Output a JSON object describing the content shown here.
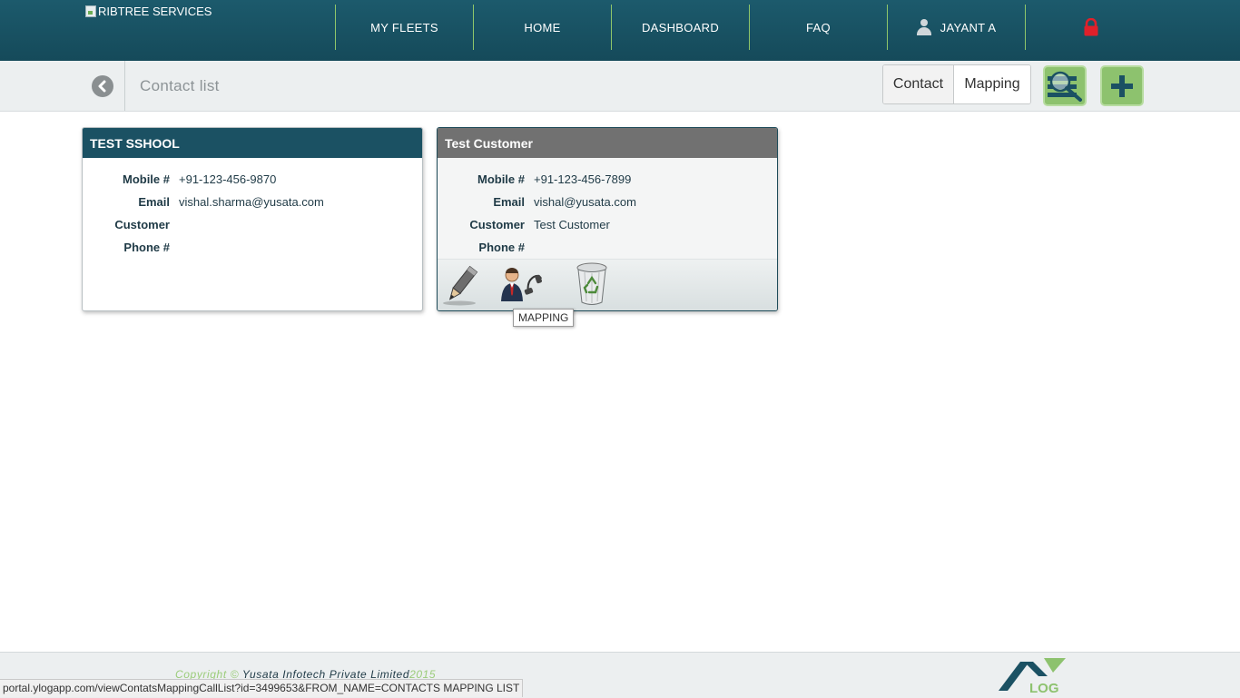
{
  "header": {
    "brand": "RIBTREE SERVICES",
    "nav": [
      {
        "label": "MY FLEETS"
      },
      {
        "label": "HOME"
      },
      {
        "label": "DASHBOARD"
      },
      {
        "label": "FAQ"
      }
    ],
    "user_name": "JAYANT A",
    "icons": {
      "user": "user-icon",
      "lock": "lock-icon"
    },
    "colors": {
      "bar": "#1c5a6c",
      "divider": "#8fc66a",
      "lock": "#e0202a"
    }
  },
  "subheader": {
    "title": "Contact list",
    "seg_contact": "Contact",
    "seg_mapping": "Mapping",
    "icons": {
      "back": "back-arrow-icon",
      "search": "search-list-icon",
      "add": "plus-icon"
    }
  },
  "cards": [
    {
      "title": "TEST SSHOOL",
      "fields": [
        {
          "label": "Mobile #",
          "value": "+91-123-456-9870"
        },
        {
          "label": "Email",
          "value": "vishal.sharma@yusata.com"
        },
        {
          "label": "Customer",
          "value": ""
        },
        {
          "label": "Phone #",
          "value": ""
        }
      ]
    },
    {
      "title": "Test Customer",
      "fields": [
        {
          "label": "Mobile #",
          "value": "+91-123-456-7899"
        },
        {
          "label": "Email",
          "value": "vishal@yusata.com"
        },
        {
          "label": "Customer",
          "value": "Test Customer"
        },
        {
          "label": "Phone #",
          "value": ""
        }
      ],
      "actions": [
        "pencil-icon",
        "mapping-icon",
        "recycle-bin-icon"
      ]
    }
  ],
  "tooltip": "MAPPING",
  "footer": {
    "copyright_prefix": "Copyright © ",
    "company": "Yusata Infotech Private Limited",
    "year": "2015",
    "logo_text": "LOG"
  },
  "status_url": "portal.ylogapp.com/viewContatsMappingCallList?id=3499653&FROM_NAME=CONTACTS MAPPING LIST"
}
